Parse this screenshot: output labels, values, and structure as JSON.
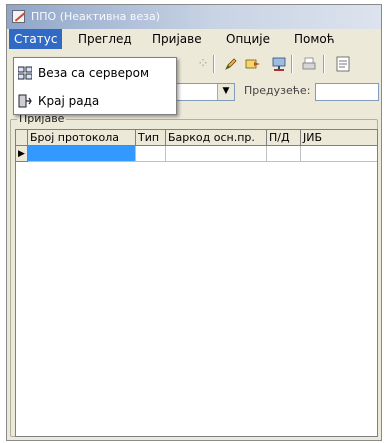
{
  "window": {
    "title": "ППО (Неактивна веза)"
  },
  "menubar": {
    "items": [
      "Статус",
      "Преглед",
      "Пријаве",
      "Опције",
      "Помоћ"
    ]
  },
  "status_menu": {
    "items": [
      {
        "label": "Веза са сервером",
        "icon": "server-connection-icon"
      },
      {
        "label": "Крај рада",
        "icon": "exit-icon"
      }
    ]
  },
  "filter": {
    "company_label": "Предузеће:",
    "company_value": ""
  },
  "group": {
    "title": "Пријаве"
  },
  "grid": {
    "columns": [
      "Број протокола",
      "Тип",
      "Баркод осн.пр.",
      "П/Д",
      "ЈИБ"
    ],
    "row_indicator": "▶"
  },
  "colors": {
    "menu_active": "#316ac5",
    "selected_cell": "#3399ff",
    "window_bg": "#ece9d8"
  }
}
